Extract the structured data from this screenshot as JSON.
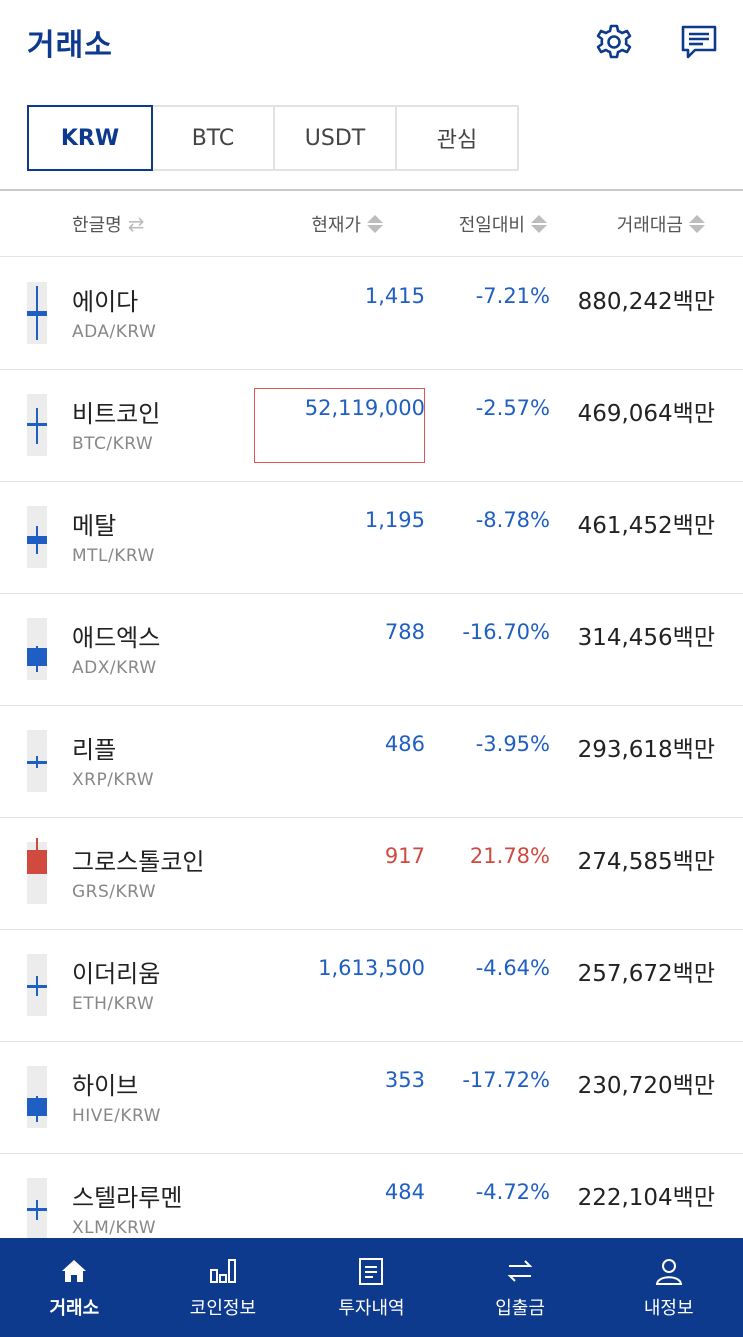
{
  "header": {
    "title": "거래소"
  },
  "tabs": [
    {
      "label": "KRW",
      "active": true
    },
    {
      "label": "BTC",
      "active": false
    },
    {
      "label": "USDT",
      "active": false
    },
    {
      "label": "관심",
      "active": false
    }
  ],
  "columns": {
    "name": "한글명",
    "price": "현재가",
    "change": "전일대비",
    "volume": "거래대금"
  },
  "colors": {
    "brand": "#0d3a8c",
    "down": "#1f5fc4",
    "up": "#d04a3f"
  },
  "coins": [
    {
      "name": "에이다",
      "symbol": "ADA/KRW",
      "price": "1,415",
      "change": "-7.21%",
      "volume": "880,242백만",
      "direction": "down"
    },
    {
      "name": "비트코인",
      "symbol": "BTC/KRW",
      "price": "52,119,000",
      "change": "-2.57%",
      "volume": "469,064백만",
      "direction": "down"
    },
    {
      "name": "메탈",
      "symbol": "MTL/KRW",
      "price": "1,195",
      "change": "-8.78%",
      "volume": "461,452백만",
      "direction": "down"
    },
    {
      "name": "애드엑스",
      "symbol": "ADX/KRW",
      "price": "788",
      "change": "-16.70%",
      "volume": "314,456백만",
      "direction": "down"
    },
    {
      "name": "리플",
      "symbol": "XRP/KRW",
      "price": "486",
      "change": "-3.95%",
      "volume": "293,618백만",
      "direction": "down"
    },
    {
      "name": "그로스톨코인",
      "symbol": "GRS/KRW",
      "price": "917",
      "change": "21.78%",
      "volume": "274,585백만",
      "direction": "up"
    },
    {
      "name": "이더리움",
      "symbol": "ETH/KRW",
      "price": "1,613,500",
      "change": "-4.64%",
      "volume": "257,672백만",
      "direction": "down"
    },
    {
      "name": "하이브",
      "symbol": "HIVE/KRW",
      "price": "353",
      "change": "-17.72%",
      "volume": "230,720백만",
      "direction": "down"
    },
    {
      "name": "스텔라루멘",
      "symbol": "XLM/KRW",
      "price": "484",
      "change": "-4.72%",
      "volume": "222,104백만",
      "direction": "down"
    }
  ],
  "bottom_nav": [
    {
      "label": "거래소",
      "icon": "home-icon",
      "active": true
    },
    {
      "label": "코인정보",
      "icon": "bar-chart-icon",
      "active": false
    },
    {
      "label": "투자내역",
      "icon": "document-icon",
      "active": false
    },
    {
      "label": "입출금",
      "icon": "transfer-icon",
      "active": false
    },
    {
      "label": "내정보",
      "icon": "user-icon",
      "active": false
    }
  ]
}
